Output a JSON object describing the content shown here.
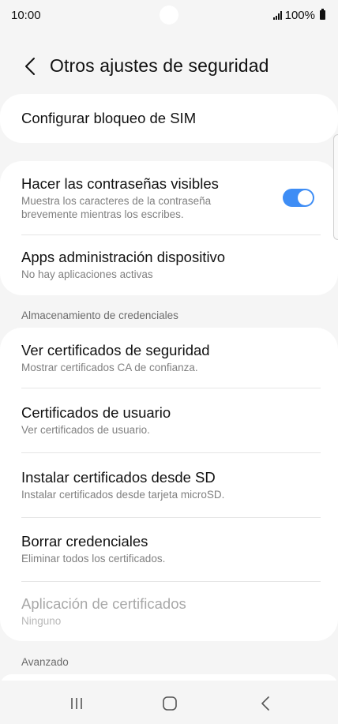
{
  "status_bar": {
    "time": "10:00",
    "battery": "100%"
  },
  "header": {
    "title": "Otros ajustes de seguridad"
  },
  "items": {
    "sim_lock": {
      "title": "Configurar bloqueo de SIM"
    },
    "show_passwords": {
      "title": "Hacer las contraseñas visibles",
      "subtitle_line1": "Muestra los caracteres de la contraseña",
      "subtitle_line2": "brevemente mientras los escribes.",
      "toggle_on": true
    },
    "device_admin": {
      "title": "Apps administración dispositivo",
      "subtitle": "No hay aplicaciones activas"
    }
  },
  "sections": {
    "credentials": "Almacenamiento de credenciales",
    "advanced": "Avanzado"
  },
  "credentials": {
    "view_certs": {
      "title": "Ver certificados de seguridad",
      "subtitle": "Mostrar certificados CA de confianza."
    },
    "user_certs": {
      "title": "Certificados de usuario",
      "subtitle": "Ver certificados de usuario."
    },
    "install_sd": {
      "title": "Instalar certificados desde SD",
      "subtitle": "Instalar certificados desde tarjeta microSD."
    },
    "clear": {
      "title": "Borrar credenciales",
      "subtitle": "Eliminar todos los certificados."
    },
    "cert_app": {
      "title": "Aplicación de certificados",
      "subtitle": "Ninguno"
    }
  },
  "colors": {
    "accent": "#3e8df5",
    "background": "#f5f5f5",
    "card": "#ffffff"
  },
  "icons": {
    "back": "chevron-left-icon",
    "recents": "recent-apps-icon",
    "home": "home-icon",
    "nav_back": "nav-back-icon"
  }
}
